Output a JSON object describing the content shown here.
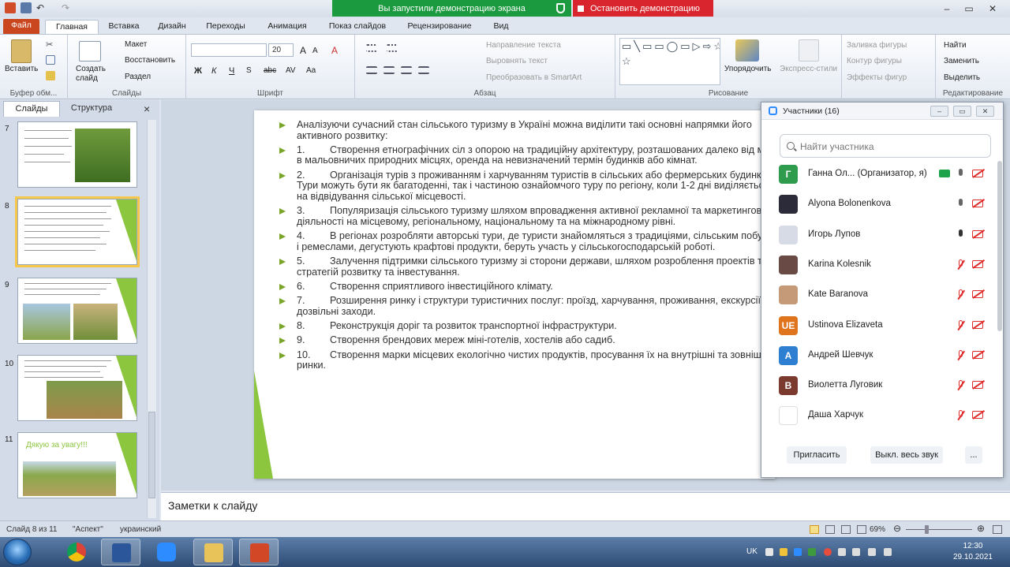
{
  "share_banner": {
    "text": "Вы запустили демонстрацию экрана",
    "stop_label": "Остановить демонстрацию"
  },
  "ribbon_tabs": [
    "Файл",
    "Главная",
    "Вставка",
    "Дизайн",
    "Переходы",
    "Анимация",
    "Показ слайдов",
    "Рецензирование",
    "Вид"
  ],
  "ribbon": {
    "clipboard": {
      "paste": "Вставить",
      "label": "Буфер обм..."
    },
    "slides": {
      "new_slide": "Создать слайд",
      "layout": "Макет",
      "reset": "Восстановить",
      "section": "Раздел",
      "label": "Слайды"
    },
    "font": {
      "size": "20",
      "label": "Шрифт",
      "bold": "Ж",
      "italic": "К",
      "underline": "Ч",
      "strike": "abc",
      "shadow": "S",
      "spacing": "AV",
      "case": "Aa",
      "grow": "A",
      "shrink": "A",
      "clear": "A"
    },
    "paragraph": {
      "text_direction": "Направление текста",
      "align_text": "Выровнять текст",
      "smartart": "Преобразовать в SmartArt",
      "label": "Абзац"
    },
    "drawing": {
      "arrange": "Упорядочить",
      "quick_styles": "Экспресс-стили",
      "fill": "Заливка фигуры",
      "outline": "Контур фигуры",
      "effects": "Эффекты фигур",
      "label": "Рисование",
      "shapes_glyphs": "▭╲▭▭◯▭▷⇨☆◁△⌐⌐⇨⊕▢⊂⤷⌒⌒{}☆"
    },
    "editing": {
      "find": "Найти",
      "replace": "Заменить",
      "select": "Выделить",
      "label": "Редактирование"
    }
  },
  "slides_pane": {
    "tab_slides": "Слайды",
    "tab_outline": "Структура",
    "close": "×",
    "slide_numbers": [
      "7",
      "8",
      "9",
      "10",
      "11"
    ],
    "thanks_text": "Дякую за увагу!!!"
  },
  "slide_content": {
    "intro": "Аналізуючи сучасний стан сільського туризму в Україні можна виділити такі основні напрямки його активного розвитку:",
    "items": [
      {
        "num": "1.",
        "text": "Створення етнографічних сіл з опорою на традиційну архітектуру, розташованих далеко від міста в мальовничих природних місцях, оренда на невизначений термін будинків або кімнат."
      },
      {
        "num": "2.",
        "text": "Організація турів з проживанням і харчуванням туристів в сільських або фермерських будинках. Тури можуть бути як багатоденні, так і частиною ознайомчого туру по регіону, коли 1-2 дні виділяється на відвідування сільської місцевості."
      },
      {
        "num": "3.",
        "text": "Популяризація сільського туризму шляхом впровадження активної рекламної та маркетингової діяльності на місцевому, регіональному, національному та на міжнародному рівні."
      },
      {
        "num": "4.",
        "text": "В регіонах розробляти авторські тури, де туристи знайомляться з традиціями, сільським побутом і ремеслами, дегустують крафтові продукти, беруть участь у сільськогосподарській роботі."
      },
      {
        "num": "5.",
        "text": "Залучення підтримки сільського туризму зі сторони держави, шляхом розроблення проектів та стратегій розвитку та інвестування."
      },
      {
        "num": "6.",
        "text": "Створення сприятливого інвестиційного клімату."
      },
      {
        "num": "7.",
        "text": "Розширення ринку і структури туристичних послуг: проїзд, харчування, проживання, екскурсії, дозвільні заходи."
      },
      {
        "num": "8.",
        "text": "Реконструкція доріг та розвиток транспортної інфраструктури."
      },
      {
        "num": "9.",
        "text": "Створення брендових мереж міні-готелів, хостелів або садиб."
      },
      {
        "num": "10.",
        "text": "Створення марки місцевих екологічно чистих продуктів, просування їх на внутрішні та зовнішні ринки."
      }
    ]
  },
  "notes_placeholder": "Заметки к слайду",
  "zoom_panel": {
    "title": "Участники (16)",
    "search_placeholder": "Найти участника",
    "participants": [
      {
        "initial": "Г",
        "name": "Ганна Ол...  (Организатор, я)",
        "color": "#2e9c4c",
        "mic": "on",
        "sharing": true
      },
      {
        "initial": "",
        "name": "Alyona Bolonenkova",
        "color": "#2b2b3a",
        "mic": "on",
        "sharing": false
      },
      {
        "initial": "",
        "name": "Игорь Лупов",
        "color": "#d6dbe6",
        "mic": "on-dark",
        "sharing": false
      },
      {
        "initial": "",
        "name": "Karina Kolesnik",
        "color": "#6a4a44",
        "mic": "off",
        "sharing": false
      },
      {
        "initial": "",
        "name": "Kate Baranova",
        "color": "#c49a78",
        "mic": "off",
        "sharing": false
      },
      {
        "initial": "UE",
        "name": "Ustinova Elizaveta",
        "color": "#e0741d",
        "mic": "off",
        "sharing": false
      },
      {
        "initial": "А",
        "name": "Андрей Шевчук",
        "color": "#2e7fd1",
        "mic": "off",
        "sharing": false
      },
      {
        "initial": "В",
        "name": "Виолетта Луговик",
        "color": "#7a3b2e",
        "mic": "off",
        "sharing": false
      },
      {
        "initial": "",
        "name": "Даша Харчук",
        "color": "#ffffff",
        "mic": "off",
        "sharing": false
      }
    ],
    "invite": "Пригласить",
    "mute_all": "Выкл. весь звук",
    "more": "..."
  },
  "status_bar": {
    "slide_of": "Слайд 8 из 11",
    "theme": "\"Аспект\"",
    "language": "украинский",
    "zoom_level": "69%"
  },
  "tray": {
    "lang": "UK",
    "time": "12:30",
    "date": "29.10.2021"
  },
  "colors": {
    "file_tab": "#c9461e",
    "banner_green": "#1c9a3f",
    "banner_red": "#d9262e",
    "slide_accent": "#8cc63f",
    "zoom_blue": "#2d8cff"
  }
}
